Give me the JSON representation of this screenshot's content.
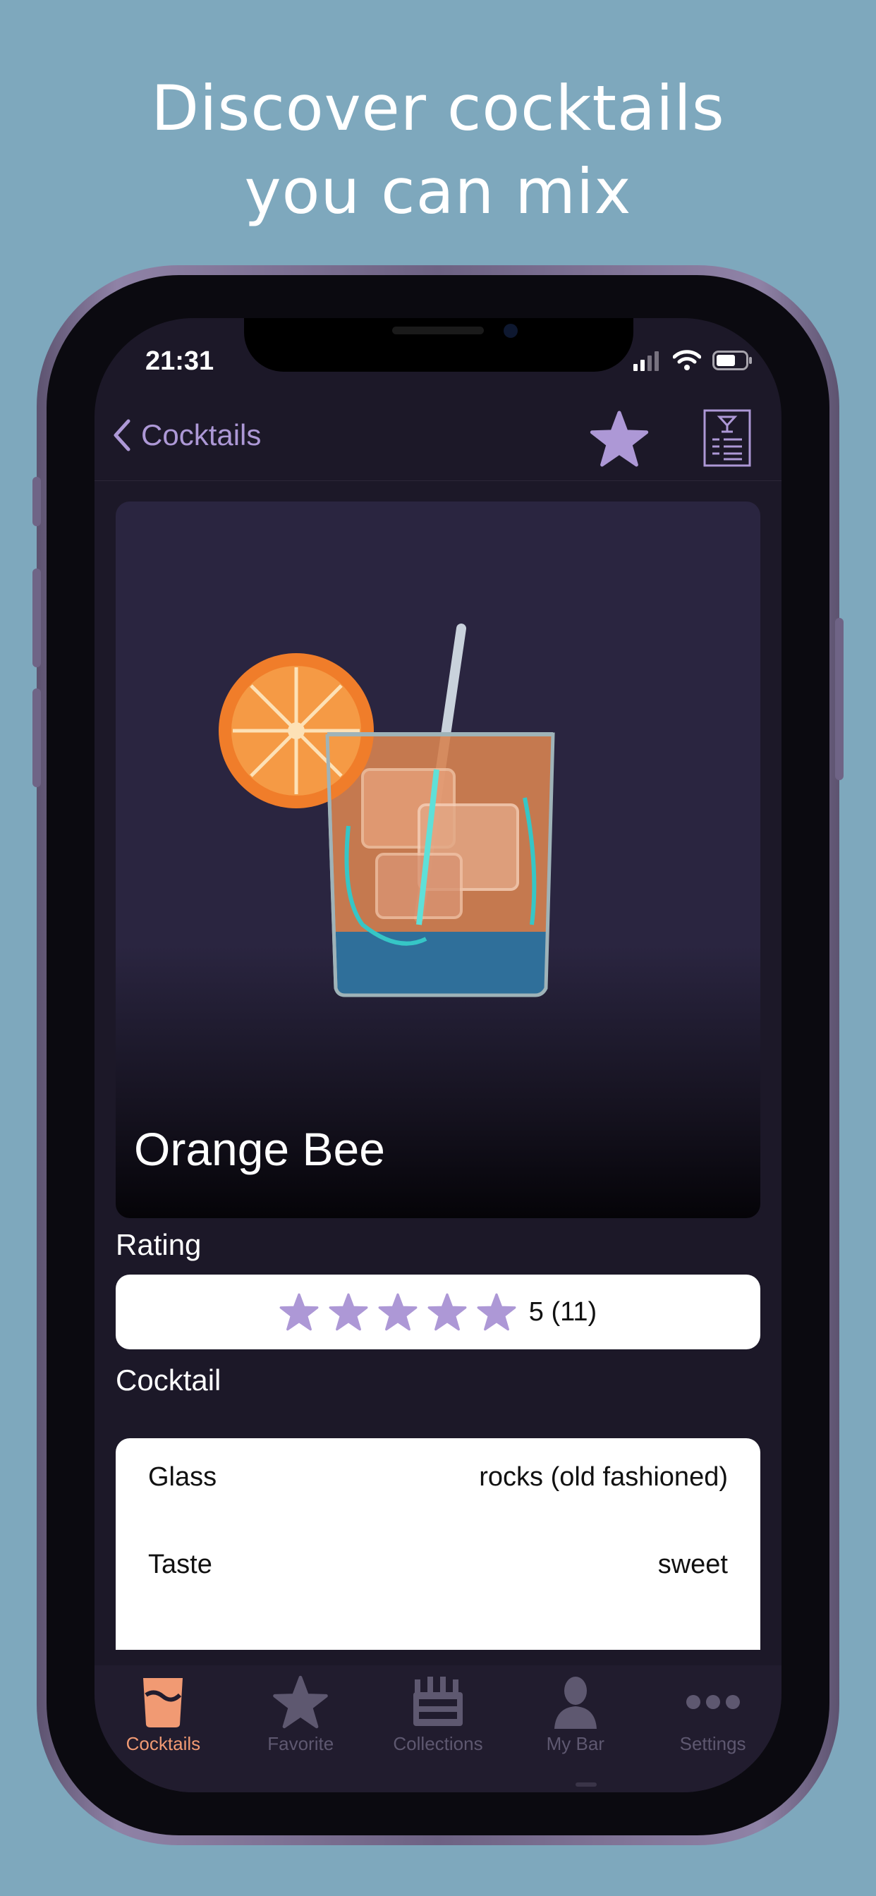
{
  "headline": {
    "line1": "Discover cocktails",
    "line2": "you can mix"
  },
  "status_bar": {
    "time": "21:31"
  },
  "nav": {
    "back_label": "Cocktails"
  },
  "cocktail": {
    "name": "Orange Bee"
  },
  "rating": {
    "section_label": "Rating",
    "value_text": "5 (11)",
    "stars_filled": 5,
    "stars_total": 5
  },
  "details": {
    "section_label": "Cocktail",
    "rows": [
      {
        "label": "Glass",
        "value": "rocks (old fashioned)"
      },
      {
        "label": "Taste",
        "value": "sweet"
      }
    ]
  },
  "tabs": [
    {
      "label": "Cocktails",
      "icon": "cocktails-glass-icon",
      "active": true
    },
    {
      "label": "Favorite",
      "icon": "star-icon",
      "active": false
    },
    {
      "label": "Collections",
      "icon": "collections-crate-icon",
      "active": false
    },
    {
      "label": "My Bar",
      "icon": "person-icon",
      "active": false
    },
    {
      "label": "Settings",
      "icon": "more-dots-icon",
      "active": false
    }
  ],
  "colors": {
    "background": "#7ea8bd",
    "screen": "#1c1828",
    "accent_lavender": "#ad98d6",
    "tab_active": "#f19a73"
  }
}
